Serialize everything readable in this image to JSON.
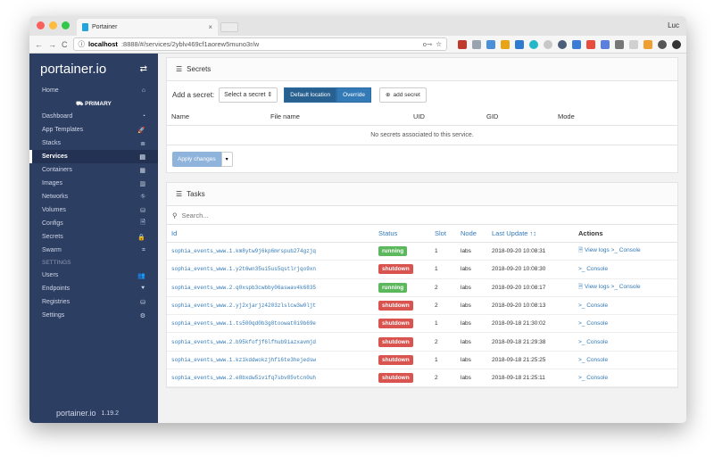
{
  "browser": {
    "tab_title": "Portainer",
    "tab_close": "×",
    "user_initials": "Luc",
    "nav_back": "←",
    "nav_forward": "→",
    "nav_reload": "C",
    "url_icon": "ⓘ",
    "url_host": "localhost",
    "url_rest": ":8888/#/services/2yblv469cf1aorew5muno3r/w",
    "url_key_icon": "o⊸",
    "url_star_icon": "☆"
  },
  "sidebar": {
    "brand": "portainer.io",
    "swap_icon": "⇄",
    "home": {
      "label": "Home",
      "icon": "⌂"
    },
    "endpoint_header": "⛟ PRIMARY",
    "endpoint_items": [
      {
        "label": "Dashboard",
        "icon": "◔"
      },
      {
        "label": "App Templates",
        "icon": "🚀"
      },
      {
        "label": "Stacks",
        "icon": "≣"
      },
      {
        "label": "Services",
        "icon": "▤"
      },
      {
        "label": "Containers",
        "icon": "▦"
      },
      {
        "label": "Images",
        "icon": "▥"
      },
      {
        "label": "Networks",
        "icon": "⛗"
      },
      {
        "label": "Volumes",
        "icon": "⛁"
      },
      {
        "label": "Configs",
        "icon": "🗎"
      },
      {
        "label": "Secrets",
        "icon": "🔒"
      },
      {
        "label": "Swarm",
        "icon": "⌗"
      }
    ],
    "settings_header": "SETTINGS",
    "settings_items": [
      {
        "label": "Users",
        "icon": "👥"
      },
      {
        "label": "Endpoints",
        "icon": "⯆"
      },
      {
        "label": "Registries",
        "icon": "⛁"
      },
      {
        "label": "Settings",
        "icon": "⚙"
      }
    ],
    "footer_brand": "portainer.io",
    "footer_version": "1.19.2"
  },
  "secrets": {
    "title": "Secrets",
    "add_label": "Add a secret:",
    "select_placeholder": "Select a secret",
    "default_location": "Default location",
    "override": "Override",
    "add_button": "add secret",
    "columns": [
      "Name",
      "File name",
      "UID",
      "GID",
      "Mode"
    ],
    "empty_message": "No secrets associated to this service.",
    "apply_button": "Apply changes",
    "caret": "▾"
  },
  "tasks": {
    "title": "Tasks",
    "search_placeholder": "Search...",
    "columns": {
      "id": "Id",
      "status": "Status",
      "slot": "Slot",
      "node": "Node",
      "last_update": "Last Update ↑↕",
      "actions": "Actions"
    },
    "rows": [
      {
        "id": "sophia_events_www.1.km8ytw9j6kp6mrspub274gzjq",
        "status": "running",
        "slot": "1",
        "node": "labs",
        "updated": "2018-09-20 10:08:31",
        "actions": "🗎 View logs >_ Console"
      },
      {
        "id": "sophia_events_www.1.y2t6wn35ui5us5qstlrjqo9xn",
        "status": "shutdown",
        "slot": "1",
        "node": "labs",
        "updated": "2018-09-20 10:08:30",
        "actions": ">_ Console"
      },
      {
        "id": "sophia_events_www.2.q0xspb3cwbby06aswav4k6835",
        "status": "running",
        "slot": "2",
        "node": "labs",
        "updated": "2018-09-20 10:08:17",
        "actions": "🗎 View logs >_ Console"
      },
      {
        "id": "sophia_events_www.2.yj2xjarjz4203zlslcw3w0ljt",
        "status": "shutdown",
        "slot": "2",
        "node": "labs",
        "updated": "2018-09-20 10:08:13",
        "actions": ">_ Console"
      },
      {
        "id": "sophia_events_www.1.ts500qd0b3g8toowat0i9b69e",
        "status": "shutdown",
        "slot": "1",
        "node": "labs",
        "updated": "2018-09-18 21:30:02",
        "actions": ">_ Console"
      },
      {
        "id": "sophia_events_www.2.b95kfofjf6lfhub9iazxavmjd",
        "status": "shutdown",
        "slot": "2",
        "node": "labs",
        "updated": "2018-09-18 21:29:38",
        "actions": ">_ Console"
      },
      {
        "id": "sophia_events_www.1.kz1kddwokzjhfi6te3hejedsw",
        "status": "shutdown",
        "slot": "1",
        "node": "labs",
        "updated": "2018-09-18 21:25:25",
        "actions": ">_ Console"
      },
      {
        "id": "sophia_events_www.2.e8bxdw5ivifq7sbv85vtcn0uh",
        "status": "shutdown",
        "slot": "2",
        "node": "labs",
        "updated": "2018-09-18 21:25:11",
        "actions": ">_ Console"
      }
    ]
  },
  "colors": {
    "running": "#5cb85c",
    "shutdown": "#d9534f",
    "sidebar": "#2d3e63",
    "accent": "#337ab7"
  }
}
